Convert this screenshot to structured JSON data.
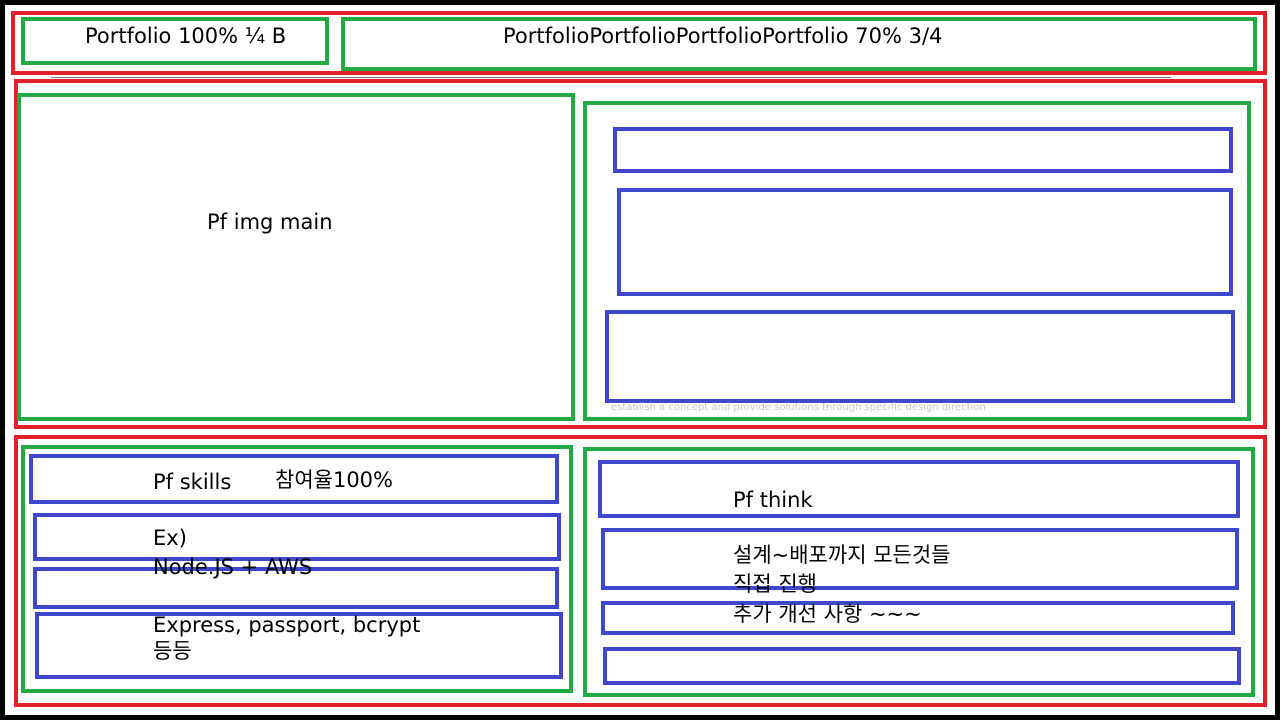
{
  "header": {
    "left_label": "Portfolio 100% ¼ B",
    "right_label": "PortfolioPortfolioPortfolioPortfolio 70% 3/4"
  },
  "main": {
    "image_label": "Pf img main",
    "faint_caption": "establish a concept and provide solutions through specific design direction"
  },
  "bottom": {
    "skills": {
      "title": "Pf skills",
      "participation": "참여율100%",
      "example_heading": "Ex)",
      "stack_line": "Node.JS + AWS",
      "libs_line": "Express, passport, bcrypt",
      "etc_line": "등등"
    },
    "think": {
      "title": "Pf think",
      "line1": "설계~배포까지 모든것들",
      "line2": "직접 진행",
      "line3": "추가 개선 사항 ~~~"
    }
  },
  "colors": {
    "outer": "#000000",
    "section": "#e0202a",
    "column": "#22aa44",
    "item": "#3f48cc"
  }
}
